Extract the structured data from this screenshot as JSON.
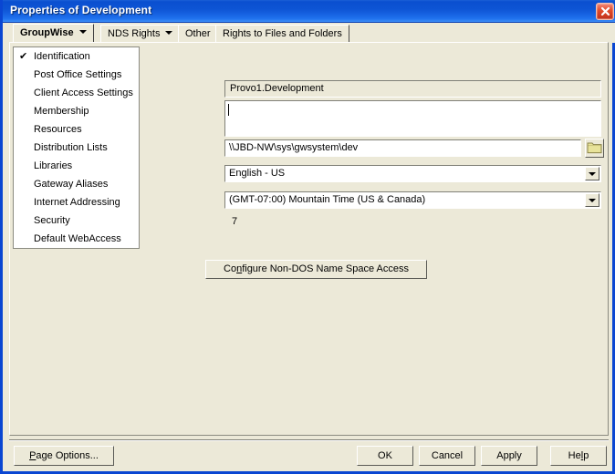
{
  "window": {
    "title": "Properties of Development",
    "close_icon": "close-icon",
    "colors": {
      "titlebar_blue": "#0a4fd0",
      "window_border": "#0a46d2",
      "face": "#ece9d8",
      "field_white": "#ffffff",
      "close_red": "#c0301a",
      "folder_yellow": "#e8e39a"
    }
  },
  "tabs": [
    {
      "label": "GroupWise",
      "active": true,
      "has_dropdown": true
    },
    {
      "label": "NDS Rights",
      "active": false,
      "has_dropdown": true
    },
    {
      "label": "Other",
      "active": false,
      "has_dropdown": false
    },
    {
      "label": "Rights to Files and Folders",
      "active": false,
      "has_dropdown": false
    }
  ],
  "sidebar": {
    "items": [
      {
        "label": "Identification",
        "selected": true,
        "check": "✔"
      },
      {
        "label": "Post Office Settings",
        "selected": false,
        "check": ""
      },
      {
        "label": "Client Access Settings",
        "selected": false,
        "check": ""
      },
      {
        "label": "Membership",
        "selected": false,
        "check": ""
      },
      {
        "label": "Resources",
        "selected": false,
        "check": ""
      },
      {
        "label": "Distribution Lists",
        "selected": false,
        "check": ""
      },
      {
        "label": "Libraries",
        "selected": false,
        "check": ""
      },
      {
        "label": "Gateway Aliases",
        "selected": false,
        "check": ""
      },
      {
        "label": "Internet Addressing",
        "selected": false,
        "check": ""
      },
      {
        "label": "Security",
        "selected": false,
        "check": ""
      },
      {
        "label": "Default WebAccess",
        "selected": false,
        "check": ""
      }
    ]
  },
  "form": {
    "name_value": "Provo1.Development",
    "description_value": "",
    "path_value": "\\\\JBD-NW\\sys\\gwsystem\\dev",
    "browse_icon": "folder-icon",
    "language_value": "English - US",
    "timezone_value": "(GMT-07:00) Mountain Time (US & Canada)",
    "dropdown_icon": "chevron-down-icon",
    "extra_label": "7",
    "nondos_button": {
      "prefix": "Co",
      "accel": "n",
      "suffix": "figure Non-DOS Name Space Access"
    }
  },
  "footer": {
    "page_options": {
      "accel": "P",
      "suffix": "age Options..."
    },
    "ok": "OK",
    "cancel": "Cancel",
    "apply": "Apply",
    "help": {
      "prefix": "He",
      "accel": "l",
      "suffix": "p"
    }
  }
}
